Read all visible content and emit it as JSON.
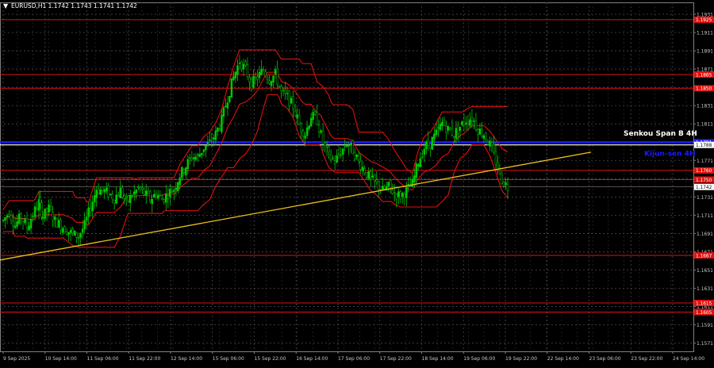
{
  "header": {
    "symbol_info": "EURUSD,H1  1.1742 1.1743 1.1741 1.1742",
    "arrow": "▼"
  },
  "colors": {
    "background": "#000000",
    "grid": "#4a4a4a",
    "bull_candle": "#00c800",
    "bear_candle": "#00c800",
    "ichimoku": "#e01010",
    "trendline": "#f0c020",
    "level_blue": "#1a1aff",
    "level_white": "#ffffff",
    "axis_text": "#c8c8c8",
    "price_tag_red": "#e01010",
    "price_tag_current": "#ffffff"
  },
  "chart_data": {
    "type": "candlestick",
    "ylim": [
      1.1562,
      1.1944
    ],
    "y_ticks": [
      "1.1931",
      "1.1911",
      "1.1891",
      "1.1871",
      "1.1851",
      "1.1831",
      "1.1811",
      "1.1791",
      "1.1771",
      "1.1751",
      "1.1731",
      "1.1711",
      "1.1691",
      "1.1671",
      "1.1651",
      "1.1631",
      "1.1611",
      "1.1591",
      "1.1571"
    ],
    "x_ticks": [
      "9 Sep 2025",
      "10 Sep 14:00",
      "11 Sep 06:00",
      "11 Sep 22:00",
      "12 Sep 14:00",
      "15 Sep 06:00",
      "15 Sep 22:00",
      "16 Sep 14:00",
      "17 Sep 06:00",
      "17 Sep 22:00",
      "18 Sep 14:00",
      "19 Sep 06:00",
      "19 Sep 22:00",
      "22 Sep 14:00",
      "23 Sep 06:00",
      "23 Sep 22:00",
      "24 Sep 14:00"
    ],
    "close_path": [
      [
        0,
        1.1705
      ],
      [
        6,
        1.1715
      ],
      [
        12,
        1.17
      ],
      [
        18,
        1.171
      ],
      [
        24,
        1.1698
      ],
      [
        30,
        1.1712
      ],
      [
        36,
        1.1725
      ],
      [
        40,
        1.171
      ],
      [
        46,
        1.1718
      ],
      [
        52,
        1.1705
      ],
      [
        58,
        1.17
      ],
      [
        64,
        1.1695
      ],
      [
        70,
        1.169
      ],
      [
        76,
        1.1688
      ],
      [
        82,
        1.17
      ],
      [
        88,
        1.172
      ],
      [
        94,
        1.174
      ],
      [
        100,
        1.1738
      ],
      [
        106,
        1.1735
      ],
      [
        112,
        1.173
      ],
      [
        118,
        1.1738
      ],
      [
        124,
        1.1725
      ],
      [
        130,
        1.1733
      ],
      [
        136,
        1.174
      ],
      [
        142,
        1.1735
      ],
      [
        148,
        1.1728
      ],
      [
        154,
        1.1735
      ],
      [
        160,
        1.1728
      ],
      [
        166,
        1.1735
      ],
      [
        172,
        1.174
      ],
      [
        178,
        1.1755
      ],
      [
        184,
        1.1765
      ],
      [
        190,
        1.1775
      ],
      [
        196,
        1.1775
      ],
      [
        202,
        1.1785
      ],
      [
        208,
        1.179
      ],
      [
        214,
        1.18
      ],
      [
        220,
        1.1815
      ],
      [
        226,
        1.184
      ],
      [
        232,
        1.1862
      ],
      [
        238,
        1.188
      ],
      [
        244,
        1.187
      ],
      [
        250,
        1.1855
      ],
      [
        256,
        1.1862
      ],
      [
        262,
        1.187
      ],
      [
        268,
        1.186
      ],
      [
        274,
        1.1865
      ],
      [
        280,
        1.1845
      ],
      [
        286,
        1.184
      ],
      [
        292,
        1.183
      ],
      [
        298,
        1.181
      ],
      [
        304,
        1.18
      ],
      [
        310,
        1.182
      ],
      [
        316,
        1.1815
      ],
      [
        322,
        1.179
      ],
      [
        328,
        1.1775
      ],
      [
        334,
        1.177
      ],
      [
        340,
        1.178
      ],
      [
        346,
        1.179
      ],
      [
        352,
        1.1782
      ],
      [
        358,
        1.177
      ],
      [
        364,
        1.176
      ],
      [
        370,
        1.175
      ],
      [
        376,
        1.1745
      ],
      [
        382,
        1.1738
      ],
      [
        388,
        1.1742
      ],
      [
        394,
        1.1735
      ],
      [
        400,
        1.1732
      ],
      [
        406,
        1.1738
      ],
      [
        412,
        1.1745
      ],
      [
        418,
        1.177
      ],
      [
        424,
        1.1785
      ],
      [
        430,
        1.179
      ],
      [
        436,
        1.18
      ],
      [
        442,
        1.1812
      ],
      [
        448,
        1.1805
      ],
      [
        454,
        1.18
      ],
      [
        460,
        1.1808
      ],
      [
        466,
        1.1815
      ],
      [
        472,
        1.1818
      ],
      [
        478,
        1.1805
      ],
      [
        484,
        1.18
      ],
      [
        490,
        1.1788
      ],
      [
        496,
        1.177
      ],
      [
        502,
        1.175
      ],
      [
        508,
        1.1742
      ]
    ],
    "close_x_range": [
      0,
      508
    ],
    "price_levels": [
      {
        "label": "1.1925",
        "value": 1.1925,
        "color": "red"
      },
      {
        "label": "1.1865",
        "value": 1.1865,
        "color": "red"
      },
      {
        "label": "1.1850",
        "value": 1.185,
        "color": "red"
      },
      {
        "label": "1.1791",
        "value": 1.1791,
        "color": "blue"
      },
      {
        "label": "1.1788",
        "value": 1.1788,
        "color": "white"
      },
      {
        "label": "1.1760",
        "value": 1.176,
        "color": "red"
      },
      {
        "label": "1.1750",
        "value": 1.175,
        "color": "red"
      },
      {
        "label": "1.1742",
        "value": 1.1742,
        "color": "current"
      },
      {
        "label": "1.1667",
        "value": 1.1667,
        "color": "red"
      },
      {
        "label": "1.1615",
        "value": 1.1615,
        "color": "red"
      },
      {
        "label": "1.1605",
        "value": 1.1605,
        "color": "red"
      }
    ],
    "trendline": [
      [
        0,
        1.1662
      ],
      [
        745,
        1.178
      ]
    ],
    "annotations": [
      {
        "text": "Senkou Span B 4H",
        "color": "white"
      },
      {
        "text": "Kijun-sen 4H",
        "color": "blue"
      }
    ]
  }
}
